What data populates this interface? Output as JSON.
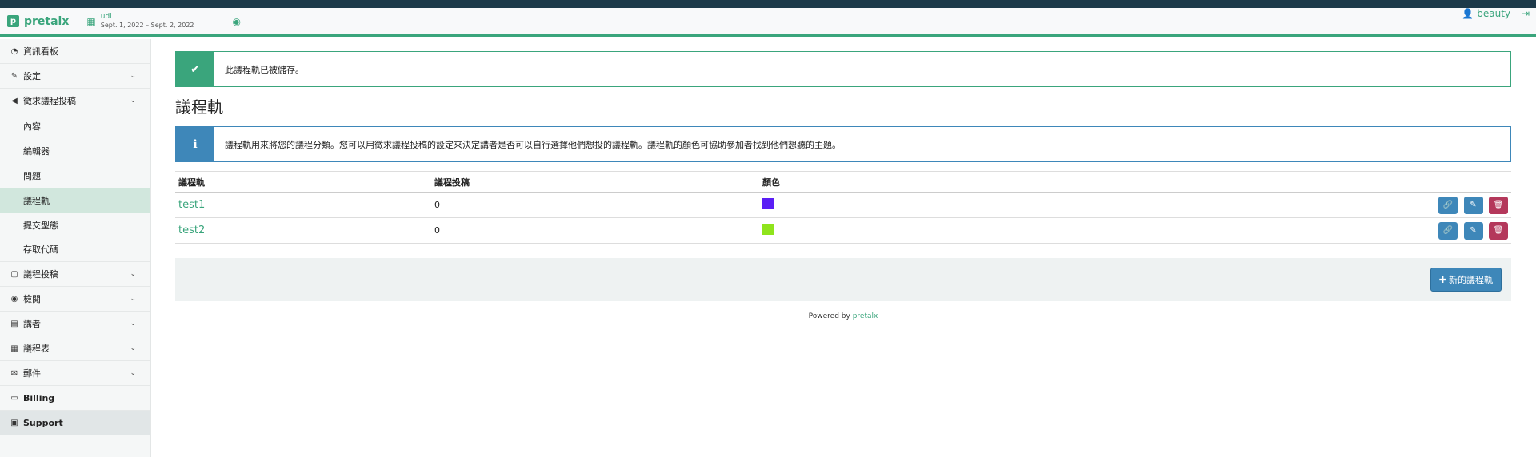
{
  "app": {
    "brand": "pretalx",
    "brand_logo": "p",
    "event_name": "udi",
    "event_dates": "Sept. 1, 2022 – Sept. 2, 2022",
    "user": "beauty"
  },
  "sidebar": {
    "items": [
      {
        "label": "資訊看板",
        "icon": "dashboard-icon",
        "chevron": false
      },
      {
        "label": "設定",
        "icon": "wrench-icon",
        "chevron": true
      },
      {
        "label": "徵求議程投稿",
        "icon": "bullhorn-icon",
        "chevron": true
      },
      {
        "label": "內容"
      },
      {
        "label": "編輯器"
      },
      {
        "label": "問題"
      },
      {
        "label": "議程軌"
      },
      {
        "label": "提交型態"
      },
      {
        "label": "存取代碼"
      },
      {
        "label": "議程投稿",
        "icon": "sticky-note-icon",
        "chevron": true
      },
      {
        "label": "檢閱",
        "icon": "eye-icon",
        "chevron": true
      },
      {
        "label": "講者",
        "icon": "id-card-icon",
        "chevron": true
      },
      {
        "label": "議程表",
        "icon": "calendar-icon",
        "chevron": true
      },
      {
        "label": "郵件",
        "icon": "envelope-icon",
        "chevron": true
      },
      {
        "label": "Billing",
        "icon": "credit-card-icon",
        "chevron": false
      },
      {
        "label": "Support",
        "icon": "briefcase-icon",
        "chevron": false
      }
    ]
  },
  "main": {
    "success_message": "此議程軌已被儲存。",
    "title": "議程軌",
    "info_message": "議程軌用來將您的議程分類。您可以用徵求議程投稿的設定來決定講者是否可以自行選擇他們想投的議程軌。議程軌的顏色可協助參加者找到他們想聽的主題。",
    "table": {
      "headers": [
        "議程軌",
        "議程投稿",
        "顏色"
      ],
      "rows": [
        {
          "name": "test1",
          "count": "0",
          "color": "#5b1ff5"
        },
        {
          "name": "test2",
          "count": "0",
          "color": "#8fe41c"
        }
      ]
    },
    "new_button": "新的議程軌",
    "powered_by": "Powered by",
    "powered_link": "pretalx"
  }
}
